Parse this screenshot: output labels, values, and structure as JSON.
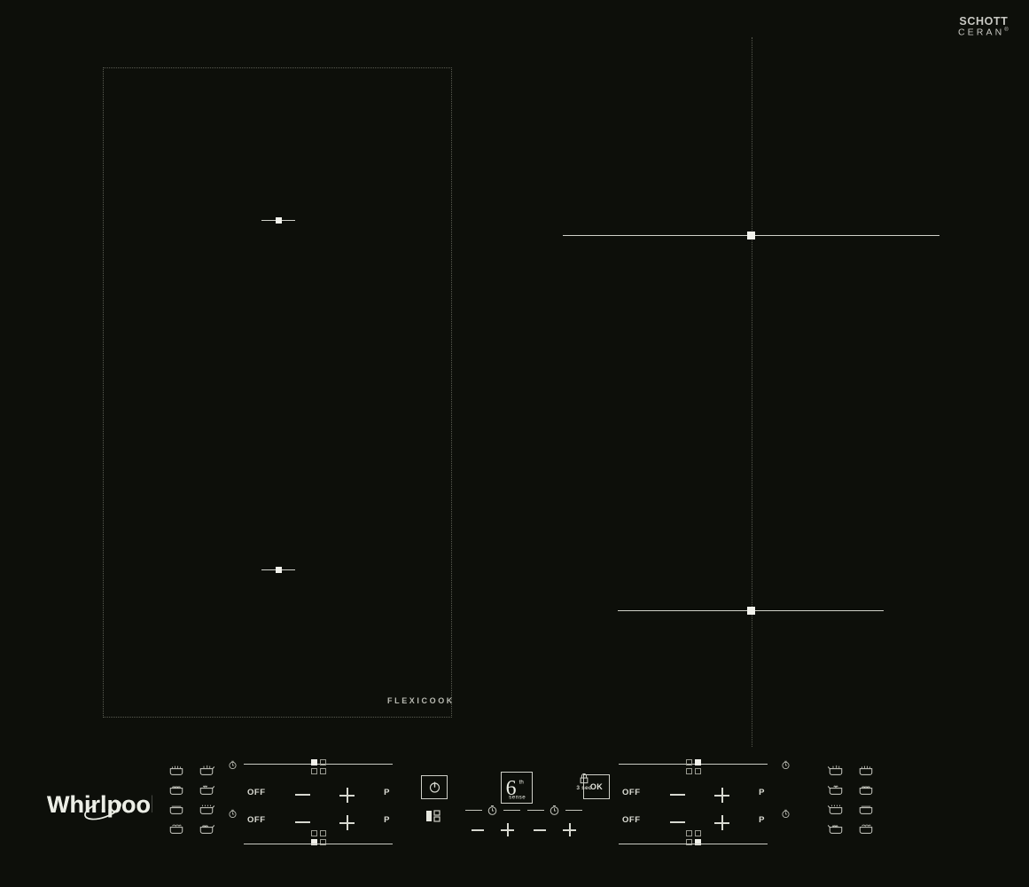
{
  "brand": {
    "glass_logo_line1": "SCHOTT",
    "glass_logo_line2": "CERAN",
    "glass_logo_registered": "®",
    "manufacturer": "Whirlpool"
  },
  "cooktop": {
    "flexicook_label": "FLEXICOOK",
    "zones": [
      {
        "name": "flexicook-front-left",
        "marker": "small-bar-dot"
      },
      {
        "name": "flexicook-rear-left",
        "marker": "small-bar-dot"
      },
      {
        "name": "rear-right",
        "marker": "large-bar-dot"
      },
      {
        "name": "front-right",
        "marker": "large-bar-dot"
      }
    ]
  },
  "controls": {
    "left_group": {
      "zone_a": {
        "off_label": "OFF",
        "minus_label": "−",
        "plus_label": "+",
        "power_boost_label": "P",
        "timer_icon": "clock-icon",
        "level_marks": [
          "on",
          "off",
          "off",
          "off"
        ]
      },
      "zone_b": {
        "off_label": "OFF",
        "minus_label": "−",
        "plus_label": "+",
        "power_boost_label": "P",
        "timer_icon": "clock-icon",
        "level_marks": [
          "off",
          "off",
          "on",
          "off"
        ]
      }
    },
    "right_group": {
      "zone_c": {
        "off_label": "OFF",
        "minus_label": "−",
        "plus_label": "+",
        "power_boost_label": "P",
        "timer_icon": "clock-icon",
        "level_marks": [
          "off",
          "on",
          "off",
          "off"
        ]
      },
      "zone_d": {
        "off_label": "OFF",
        "minus_label": "−",
        "plus_label": "+",
        "power_boost_label": "P",
        "timer_icon": "clock-icon",
        "level_marks": [
          "off",
          "off",
          "off",
          "on"
        ]
      }
    },
    "center": {
      "power_icon": "power-icon",
      "bridge_icon": "bridge-zone-icon",
      "sixth_sense": {
        "numeral": "6",
        "superscript": "th",
        "word": "sense"
      },
      "timer_a": {
        "icon": "clock-icon",
        "minus_label": "−",
        "plus_label": "+"
      },
      "timer_b": {
        "icon": "clock-icon",
        "minus_label": "−",
        "plus_label": "+"
      },
      "lock": {
        "icon": "padlock-icon",
        "hold_label": "3 sec"
      },
      "ok_label": "OK"
    }
  },
  "function_icons": {
    "left": [
      "pan-simmer-icon",
      "pan-melt-icon",
      "pot-boil-icon",
      "pot-keepwarm-icon",
      "pan-fry-icon",
      "pan-grill-icon",
      "pot-steam-icon",
      "pot-stew-icon"
    ],
    "right": [
      "pan-melt-icon",
      "pan-simmer-icon",
      "pot-keepwarm-icon",
      "pot-boil-icon",
      "pan-grill-icon",
      "pan-fry-icon",
      "pot-stew-icon",
      "pot-steam-icon"
    ]
  },
  "colors": {
    "glass": "#0d0f0a",
    "print": "#d7d8d0",
    "dotted": "#55574e",
    "marker": "#f2f2ec"
  }
}
